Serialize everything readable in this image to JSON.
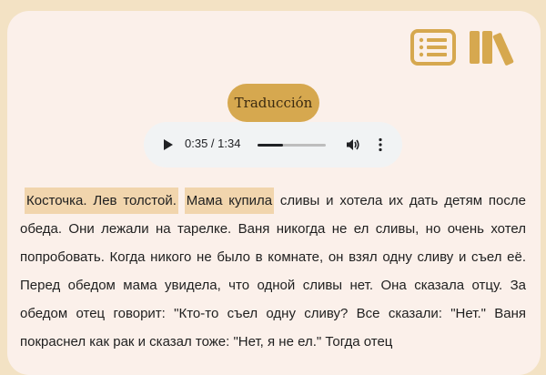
{
  "translate_button": "Traducción",
  "audio": {
    "time": "0:35 / 1:34",
    "progress": 0.372
  },
  "icons": {
    "contents": "list-icon",
    "library": "books-icon",
    "play": "play-icon",
    "volume": "volume-icon",
    "more": "more-vert-icon"
  },
  "colors": {
    "background": "#f3e2c4",
    "card": "#fbf0ea",
    "accent": "#d6a84f",
    "highlight": "#f1d5ad"
  },
  "story": {
    "highlight_1": "Косточка. Лев толстой.",
    "highlight_2": "Мама купила",
    "body": " сливы и хотела их дать детям после обеда. Они лежали на тарелке. Ваня никогда не ел сливы, но очень хотел попробовать. Когда никого не было в комнате, он взял одну сливу и съел её. Перед обедом мама увидела, что одной сливы нет. Она сказала отцу. За обедом отец говорит: \"Кто-то съел одну сливу? Все сказали: \"Нет.\" Ваня покраснел как рак и сказал тоже: \"Нет, я не ел.\" Тогда отец"
  }
}
